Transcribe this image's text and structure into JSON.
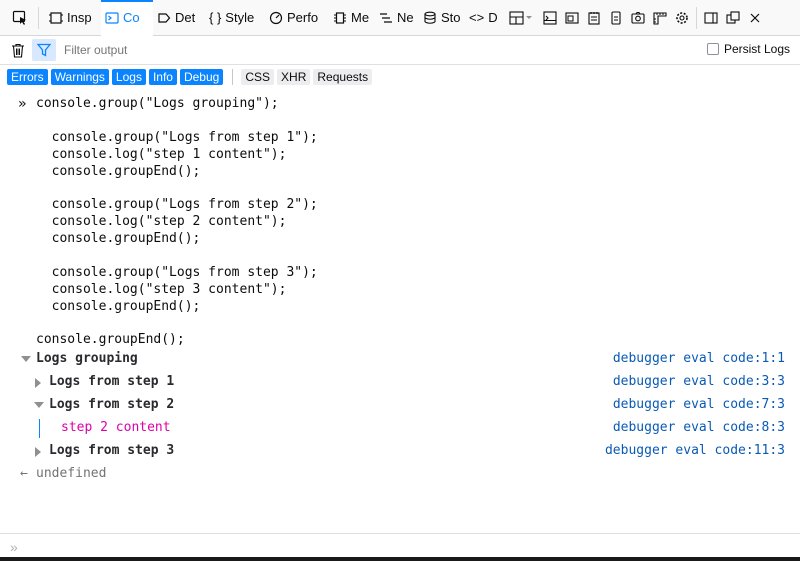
{
  "toolbar": {
    "tabs": [
      {
        "label": "Insp",
        "icon": "inspector-icon"
      },
      {
        "label": "Co",
        "icon": "console-icon"
      },
      {
        "label": "Det",
        "icon": "debugger-icon"
      },
      {
        "label": "Style",
        "icon": "style-editor-icon"
      },
      {
        "label": "Perfo",
        "icon": "performance-icon"
      },
      {
        "label": "Me",
        "icon": "memory-icon"
      },
      {
        "label": "Ne",
        "icon": "network-icon"
      },
      {
        "label": "Sto",
        "icon": "storage-icon"
      },
      {
        "label": "D",
        "icon": "dom-icon"
      }
    ],
    "active_tab": "Co",
    "accent": "#0a84ff"
  },
  "filter": {
    "placeholder": "Filter output",
    "persist_label": "Persist Logs"
  },
  "categories": {
    "levels": [
      "Errors",
      "Warnings",
      "Logs",
      "Info",
      "Debug"
    ],
    "types": [
      "CSS",
      "XHR",
      "Requests"
    ]
  },
  "command": {
    "lines": [
      "console.group(\"Logs grouping\");",
      "",
      "  console.group(\"Logs from step 1\");",
      "  console.log(\"step 1 content\");",
      "  console.groupEnd();",
      "",
      "  console.group(\"Logs from step 2\");",
      "  console.log(\"step 2 content\");",
      "  console.groupEnd();",
      "",
      "  console.group(\"Logs from step 3\");",
      "  console.log(\"step 3 content\");",
      "  console.groupEnd();",
      "",
      "console.groupEnd();"
    ]
  },
  "messages": [
    {
      "text": "Logs grouping",
      "location": "debugger eval code:1:1",
      "expanded": true
    },
    {
      "text": "Logs from step 1",
      "location": "debugger eval code:3:3",
      "expanded": false
    },
    {
      "text": "Logs from step 2",
      "location": "debugger eval code:7:3",
      "expanded": true
    },
    {
      "text": "step 2 content",
      "location": "debugger eval code:8:3"
    },
    {
      "text": "Logs from step 3",
      "location": "debugger eval code:11:3",
      "expanded": false
    }
  ],
  "result": "undefined"
}
